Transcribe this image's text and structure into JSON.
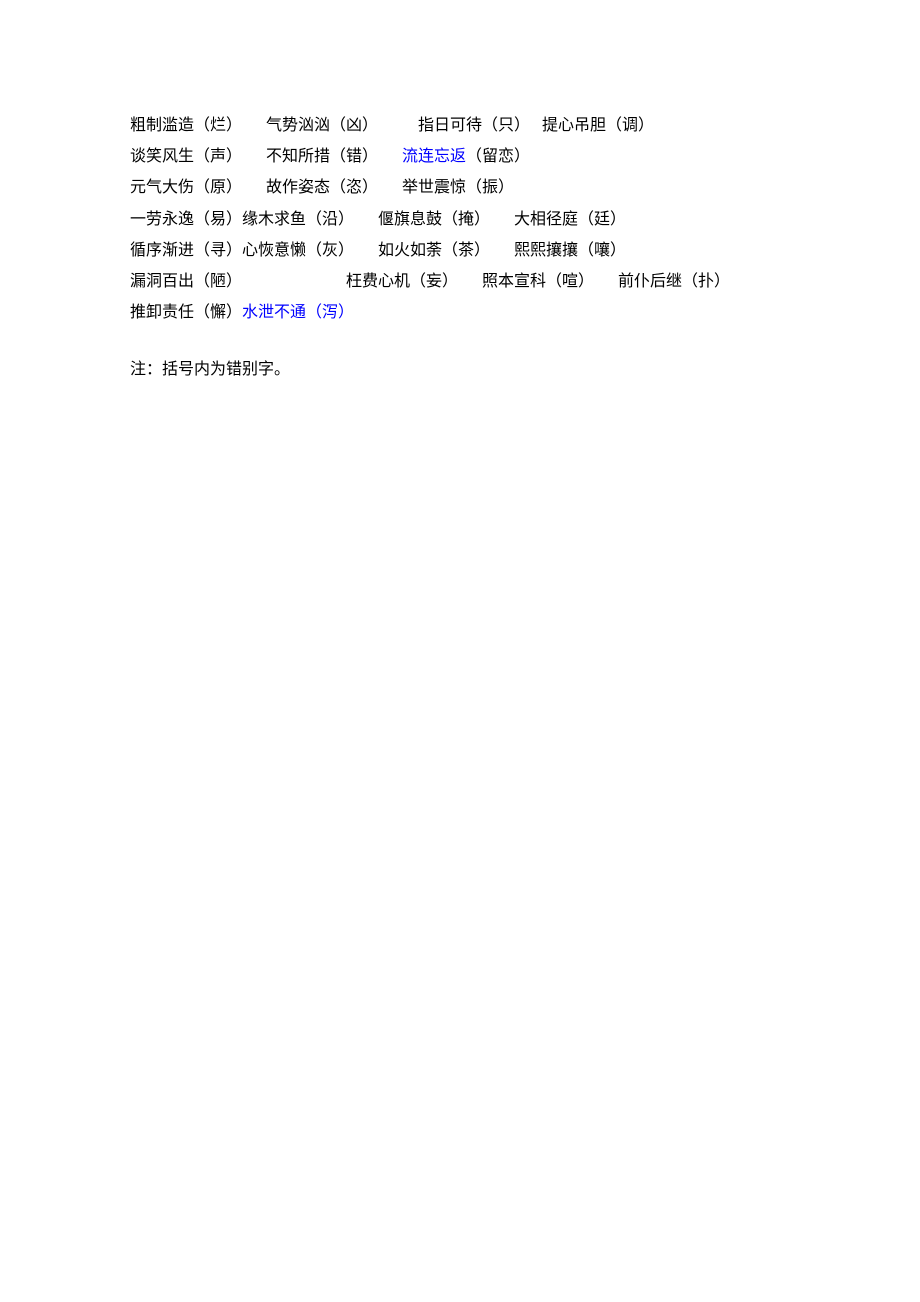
{
  "lines": [
    {
      "segments": [
        {
          "text": "粗制滥造（烂）　　气势汹汹（凶）　　　指日可待（只）　 提心吊胆（调）"
        }
      ]
    },
    {
      "segments": [
        {
          "text": "谈笑风生（声）　　不知所措（错）　　"
        },
        {
          "text": "流连忘返",
          "blue": true
        },
        {
          "text": "（留恋）"
        }
      ]
    },
    {
      "segments": [
        {
          "text": "元气大伤（原）　　故作姿态（恣）　　举世震惊（振）"
        }
      ]
    },
    {
      "segments": [
        {
          "text": "一劳永逸（易）缘木求鱼（沿）　　偃旗息鼓（掩）　　大相径庭（廷）"
        }
      ]
    },
    {
      "segments": [
        {
          "text": "循序渐进（寻）心恢意懒（灰）　　如火如荼（茶）　　熙熙攘攘（嚷）"
        }
      ]
    },
    {
      "segments": [
        {
          "text": "漏洞百出（陋）　　　　　　　枉费心机（妄）　　照本宣科（喧）　　前仆后继（扑）"
        }
      ]
    },
    {
      "segments": [
        {
          "text": "推卸责任（懈）"
        },
        {
          "text": "水泄不通（泻）",
          "blue": true
        }
      ]
    }
  ],
  "note": "注：括号内为错别字。"
}
